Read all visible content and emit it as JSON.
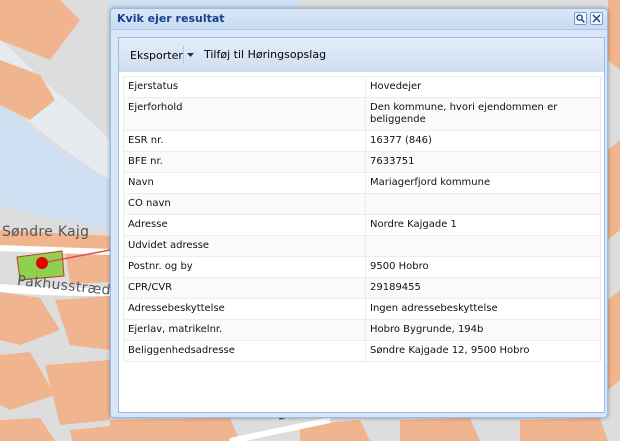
{
  "map": {
    "labels": {
      "street_1": "Søndre Kajg",
      "street_2": "Pakhusstræd",
      "street_3": "Beltoftsg"
    }
  },
  "window": {
    "title": "Kvik ejer resultat",
    "toolbar": {
      "export_label": "Eksporter",
      "add_label": "Tilføj til Høringsopslag"
    },
    "rows": [
      {
        "key": "Ejerstatus",
        "value": "Hovedejer"
      },
      {
        "key": "Ejerforhold",
        "value": "Den kommune, hvori ejendommen er beliggende"
      },
      {
        "key": "ESR nr.",
        "value": "16377 (846)"
      },
      {
        "key": "BFE nr.",
        "value": "7633751"
      },
      {
        "key": "Navn",
        "value": "Mariagerfjord kommune"
      },
      {
        "key": "CO navn",
        "value": ""
      },
      {
        "key": "Adresse",
        "value": "Nordre Kajgade 1"
      },
      {
        "key": "Udvidet adresse",
        "value": ""
      },
      {
        "key": "Postnr. og by",
        "value": "9500 Hobro"
      },
      {
        "key": "CPR/CVR",
        "value": "29189455"
      },
      {
        "key": "Adressebeskyttelse",
        "value": "Ingen adressebeskyttelse"
      },
      {
        "key": "Ejerlav, matrikelnr.",
        "value": "Hobro Bygrunde, 194b"
      },
      {
        "key": "Beliggenhedsadresse",
        "value": "Søndre Kajgade 12, 9500 Hobro"
      }
    ]
  },
  "colors": {
    "water": "#cfe0f2",
    "land": "#dcdcdc",
    "buildings": "#f0b48f",
    "parcel": "#8fd050",
    "marker": "#e60000",
    "title_text": "#15428b"
  }
}
